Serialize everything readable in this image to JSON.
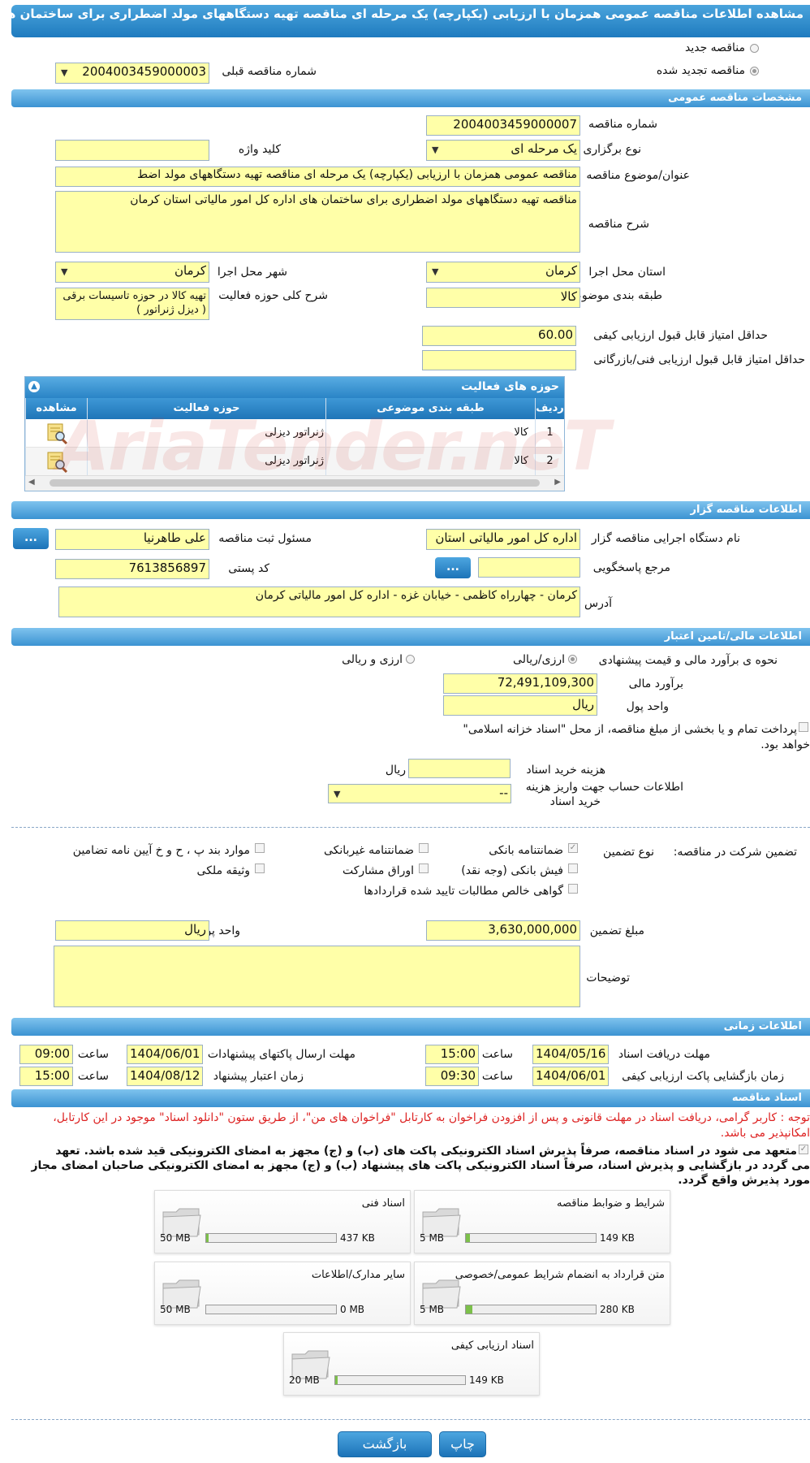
{
  "page_title": "مشاهده اطلاعات مناقصه عمومی همزمان با ارزیابی (یکپارچه) یک مرحله ای مناقصه تهیه دستگاههای مولد اضطراری برای ساختمان های اداره کل امور مالیاتی استان کرمان",
  "top": {
    "new_tender_label": "مناقصه جدید",
    "renewed_tender_label": "مناقصه تجدید شده",
    "prev_tender_number_label": "شماره مناقصه قبلی",
    "prev_tender_number": "2004003459000003"
  },
  "sections": {
    "general": "مشخصات مناقصه عمومی",
    "organizer": "اطلاعات مناقصه گزار",
    "financial": "اطلاعات مالی/تامین اعتبار",
    "timing": "اطلاعات زمانی",
    "documents": "اسناد مناقصه"
  },
  "general": {
    "tender_number_label": "شماره مناقصه",
    "tender_number": "2004003459000007",
    "holding_type_label": "نوع برگزاری",
    "holding_type": "یک مرحله ای",
    "keyword_label": "کلید واژه",
    "keyword": "",
    "subject_label": "عنوان/موضوع مناقصه",
    "subject": "مناقصه عمومی همزمان با ارزیابی (یکپارچه) یک مرحله ای مناقصه تهیه دستگاههای مولد اضط",
    "description_label": "شرح مناقصه",
    "description": "مناقصه تهیه دستگاههای مولد اضطراری برای ساختمان های اداره کل امور مالیاتی استان کرمان",
    "province_label": "استان محل اجرا",
    "province": "کرمان",
    "city_label": "شهر محل اجرا",
    "city": "کرمان",
    "category_label": "طبقه بندی موضوعی",
    "category": "کالا",
    "activity_desc_label": "شرح کلی حوزه فعالیت",
    "activity_desc": "تهیه کالا در حوزه تاسیسات برقی ( دیزل ژنراتور )",
    "min_quality_label": "حداقل امتیاز قابل قبول ارزیابی کیفی",
    "min_quality": "60.00",
    "min_tech_label": "حداقل امتیاز قابل قبول ارزیابی فنی/بازرگانی",
    "min_tech": ""
  },
  "activity_grid": {
    "title": "حوزه های فعالیت",
    "headers": {
      "row": "ردیف",
      "category": "طبقه بندی موضوعی",
      "field": "حوزه فعالیت",
      "view": "مشاهده"
    },
    "rows": [
      {
        "row": "1",
        "category": "کالا",
        "field": "ژنراتور دیزلی"
      },
      {
        "row": "2",
        "category": "کالا",
        "field": "ژنراتور دیزلی"
      }
    ]
  },
  "watermark": "AriaTender.neT",
  "organizer": {
    "org_name_label": "نام دستگاه اجرایی مناقصه گزار",
    "org_name": "اداره کل امور مالیاتی استان",
    "registrar_label": "مسئول ثبت مناقصه",
    "registrar": "علی  طاهرنیا",
    "reference_label": "مرجع پاسخگویی",
    "reference": "",
    "postal_code_label": "کد پستی",
    "postal_code": "7613856897",
    "address_label": "آدرس",
    "address": "کرمان - چهارراه کاظمی - خیابان غزه - اداره کل امور مالیاتی کرمان",
    "dots_button": "..."
  },
  "financial": {
    "estimate_method_label": "نحوه ی برآورد مالی و قیمت پیشنهادی",
    "opt_rial": "ارزی/ریالی",
    "opt_fx_rial": "ارزی و ریالی",
    "estimate_label": "برآورد مالی",
    "estimate": "72,491,109,300",
    "currency_label": "واحد پول",
    "currency": "ریال",
    "treasury_text_1": "پرداخت تمام و یا بخشی از مبلغ مناقصه، از محل \"اسناد خزانه اسلامی\"",
    "treasury_text_2": "خواهد بود.",
    "doc_cost_label": "هزینه خرید اسناد",
    "doc_cost": "",
    "doc_cost_unit": "ریال",
    "account_label_1": "اطلاعات حساب جهت واریز هزینه",
    "account_label_2": "خرید اسناد",
    "account_value": "--"
  },
  "guarantee": {
    "participation_label": "تضمین شرکت در مناقصه:",
    "type_label": "نوع تضمین",
    "bank_guarantee": "ضمانتنامه بانکی",
    "nonbank_guarantee": "ضمانتنامه غیربانکی",
    "clauses": "موارد بند پ ، ح و خ آیین نامه تضامین",
    "bank_receipt": "فیش بانکی (وجه نقد)",
    "bonds": "اوراق مشارکت",
    "property": "وثیقه ملکی",
    "claims_cert": "گواهی خالص مطالبات تایید شده قراردادها",
    "amount_label": "مبلغ تضمین",
    "amount": "3,630,000,000",
    "currency_label": "واحد پول",
    "currency": "ریال",
    "notes_label": "توضیحات",
    "notes": ""
  },
  "timing": {
    "doc_receive_label": "مهلت دریافت اسناد",
    "doc_receive_date": "1404/05/16",
    "time_label": "ساعت",
    "doc_receive_time": "15:00",
    "submit_label": "مهلت ارسال پاکتهای پیشنهادات",
    "submit_date": "1404/06/01",
    "submit_time": "09:00",
    "quality_open_label": "زمان بازگشایی پاکت ارزیابی کیفی",
    "quality_open_date": "1404/06/01",
    "quality_open_time": "09:30",
    "validity_label": "زمان اعتبار پیشنهاد",
    "validity_date": "1404/08/12",
    "validity_time": "15:00"
  },
  "documents": {
    "notice_1": "توجه : کاربر گرامی، دریافت اسناد در مهلت قانونی و پس از افزودن فراخوان به کارتابل \"فراخوان های من\"، از طریق ستون \"دانلود اسناد\" موجود در این کارتابل،",
    "notice_2": "امکانپذیر می باشد.",
    "commit_1": "متعهد می شود در اسناد مناقصه، صرفاً پذیرش اسناد الکترونیکی پاکت های (ب) و (ج) مجهز به امضای الکترونیکی قید شده باشد. تعهد",
    "commit_2": "می گردد در بازگشایی و پذیرش اسناد، صرفاً اسناد الکترونیکی پاکت های پیشنهاد (ب) و (ج) مجهز به امضای الکترونیکی صاحبان امضای مجاز",
    "commit_3": "مورد پذیرش واقع گردد.",
    "items": [
      {
        "name": "شرایط و ضوابط مناقصه",
        "current": "149 KB",
        "max": "5 MB",
        "fill": 0.03
      },
      {
        "name": "اسناد فنی",
        "current": "437 KB",
        "max": "50 MB",
        "fill": 0.01
      },
      {
        "name": "متن قرارداد به انضمام شرایط عمومی/خصوصی",
        "current": "280 KB",
        "max": "5 MB",
        "fill": 0.05
      },
      {
        "name": "سایر مدارک/اطلاعات",
        "current": "0 MB",
        "max": "50 MB",
        "fill": 0
      },
      {
        "name": "اسناد ارزیابی کیفی",
        "current": "149 KB",
        "max": "20 MB",
        "fill": 0.01
      }
    ]
  },
  "buttons": {
    "print": "چاپ",
    "back": "بازگشت"
  }
}
